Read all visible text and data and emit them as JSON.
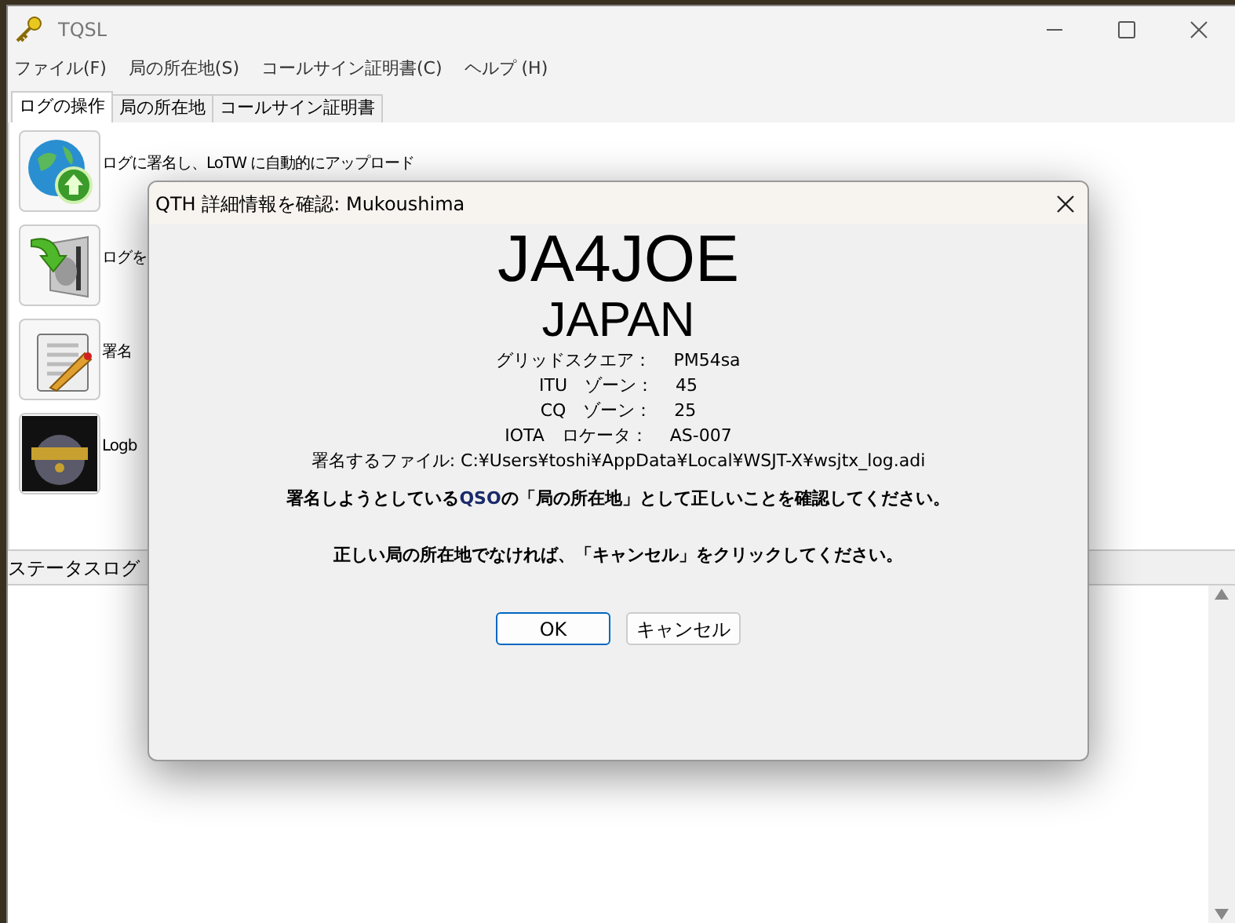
{
  "window": {
    "title": "TQSL"
  },
  "menu": [
    "ファイル(F)",
    "局の所在地(S)",
    "コールサイン証明書(C)",
    "ヘルプ (H)"
  ],
  "tabs": [
    {
      "label": "ログの操作",
      "selected": true
    },
    {
      "label": "局の所在地",
      "selected": false
    },
    {
      "label": "コールサイン証明書",
      "selected": false
    }
  ],
  "actions": [
    {
      "kind": "upload",
      "label": "ログに署名し、LoTW に自動的にアップロード"
    },
    {
      "kind": "save",
      "label": "ログを"
    },
    {
      "kind": "sign",
      "label": "署名"
    },
    {
      "kind": "logbook",
      "label": "Logb"
    }
  ],
  "status_log": {
    "title": "ステータスログ"
  },
  "dialog": {
    "title": "QTH 詳細情報を確認: Mukoushima",
    "callsign": "JA4JOE",
    "country": "JAPAN",
    "details": [
      {
        "label": "グリッドスクエア：",
        "value": "PM54sa"
      },
      {
        "label": "ITU　ゾーン：",
        "value": "45"
      },
      {
        "label": "CQ　ゾーン：",
        "value": "25"
      },
      {
        "label": "IOTA　ロケータ：",
        "value": "AS-007"
      }
    ],
    "file": "署名するファイル: C:¥Users¥toshi¥AppData¥Local¥WSJT-X¥wsjtx_log.adi",
    "messages": [
      [
        {
          "text": "署名しようとしている",
          "highlight": false
        },
        {
          "text": "QSO",
          "highlight": true
        },
        {
          "text": "の「局の所在地」として正しいことを確認してください。",
          "highlight": false
        }
      ],
      [
        {
          "text": "正しい局の所在地でなければ、「キャンセル」をクリックしてください。",
          "highlight": false
        }
      ]
    ],
    "buttons": [
      {
        "label": "OK",
        "default": true
      },
      {
        "label": "キャンセル",
        "default": false
      }
    ]
  }
}
